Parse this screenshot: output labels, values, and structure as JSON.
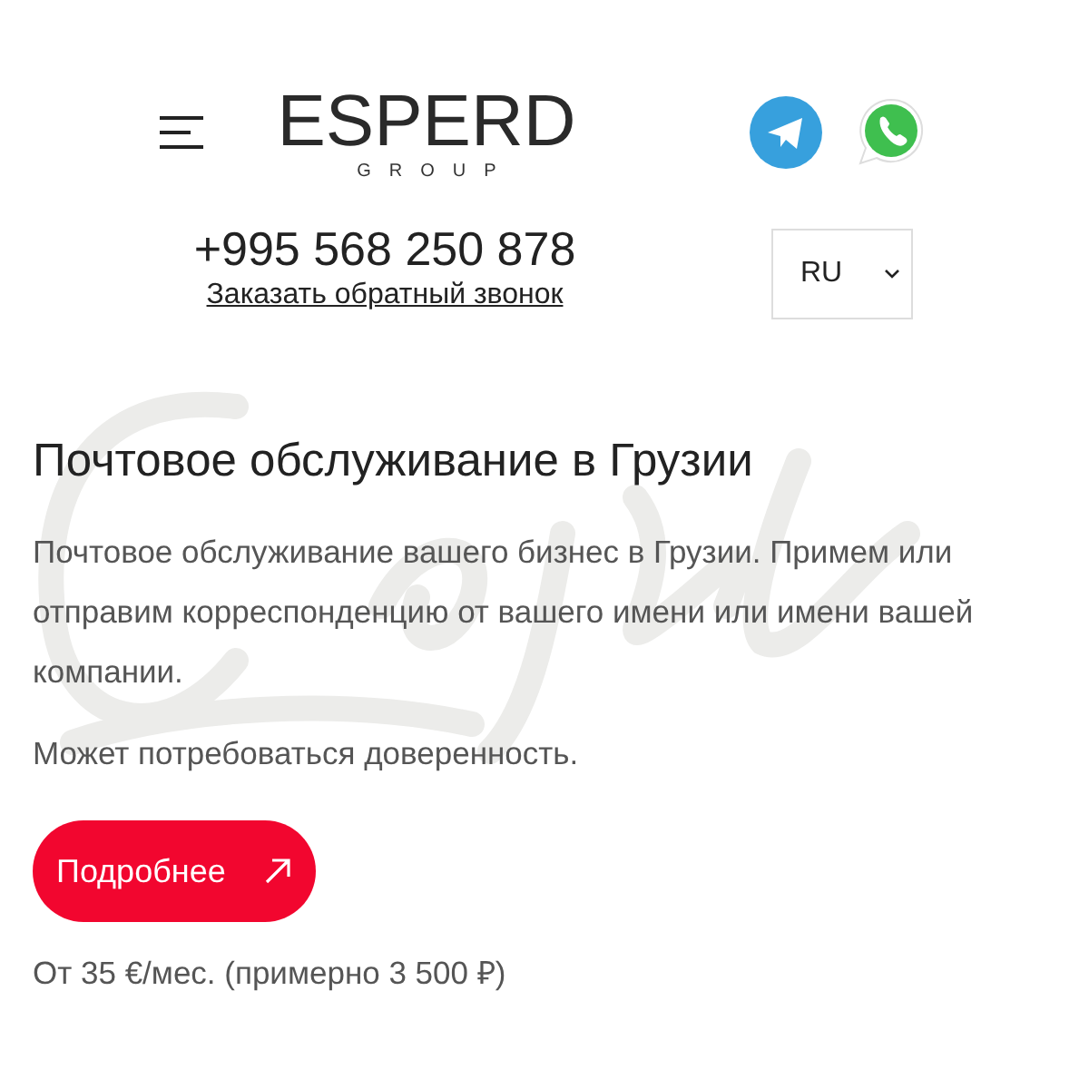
{
  "header": {
    "logo": {
      "name": "ESPERD",
      "subtitle": "GROUP"
    },
    "phone": "+995 568 250 878",
    "callback_link": "Заказать обратный звонок",
    "language": {
      "value": "RU"
    }
  },
  "section": {
    "title": "Почтовое обслуживание в Грузии",
    "paragraphs": [
      "Почтовое обслуживание вашего бизнес в Грузии. Примем или отправим корреспонденцию от вашего имени или имени вашей компании.",
      "Может потребоваться доверенность."
    ],
    "button": "Подробнее",
    "price": "От 35 €/мес. (примерно 3 500 ₽)"
  }
}
